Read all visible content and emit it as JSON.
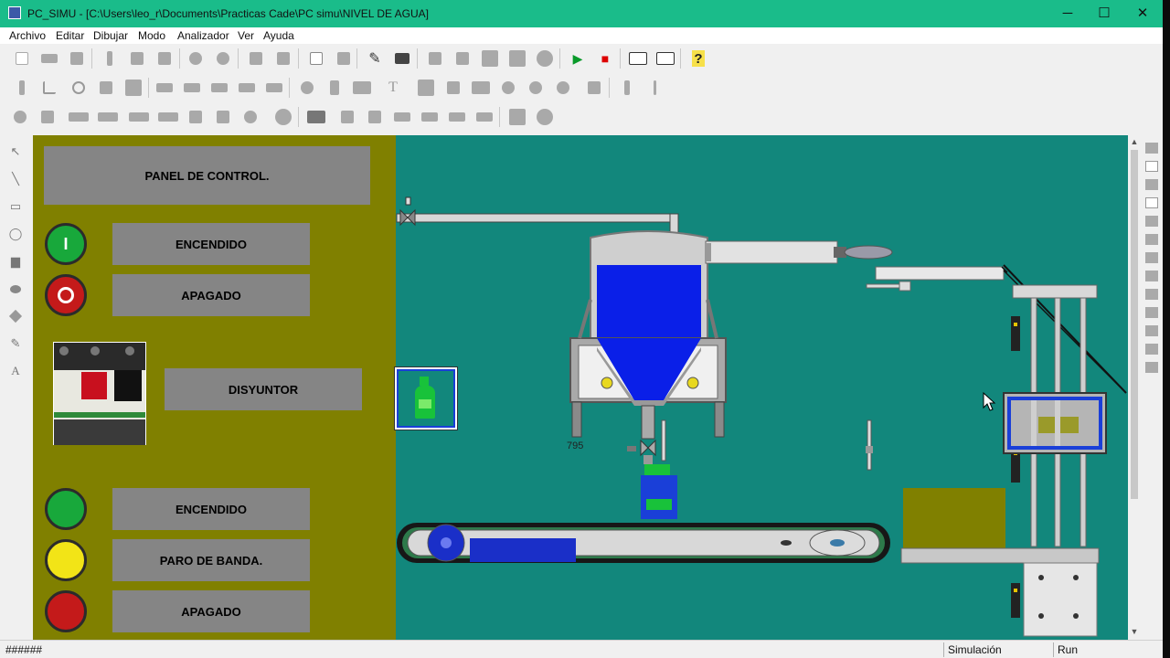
{
  "window": {
    "title": "PC_SIMU - [C:\\Users\\leo_r\\Documents\\Practicas Cade\\PC simu\\NIVEL DE AGUA]",
    "minimize": "─",
    "maximize": "☐",
    "close": "✕"
  },
  "menu": [
    "Archivo",
    "Editar",
    "Dibujar",
    "Modo",
    "Analizador",
    "Ver",
    "Ayuda"
  ],
  "toolbar": {
    "pencil": "✎",
    "run": "▶",
    "stop": "■",
    "help": "?"
  },
  "lefttools": {
    "pointer": "↖",
    "line": "╲",
    "rect": "▭",
    "ellipse": "◯",
    "fill": "▆",
    "brush": "✎",
    "text": "A"
  },
  "panel": {
    "title": "PANEL DE CONTROL.",
    "on_button_glyph": "I",
    "off_button_glyph": "O",
    "encendido_1": "ENCENDIDO",
    "apagado_1": "APAGADO",
    "disyuntor": "DISYUNTOR",
    "encendido_2": "ENCENDIDO",
    "paro_banda": "PARO DE BANDA.",
    "apagado_2": "APAGADO"
  },
  "process": {
    "level_value": "795"
  },
  "colors": {
    "titlebar": "#1abc8a",
    "canvas": "#12877c",
    "panel": "#808000",
    "water": "#0a1fe8",
    "green_lamp": "#18a83b",
    "yellow_lamp": "#f2e417",
    "red_lamp": "#c41a1a"
  },
  "status": {
    "left": "######",
    "mode": "Simulación",
    "state": "Run"
  }
}
